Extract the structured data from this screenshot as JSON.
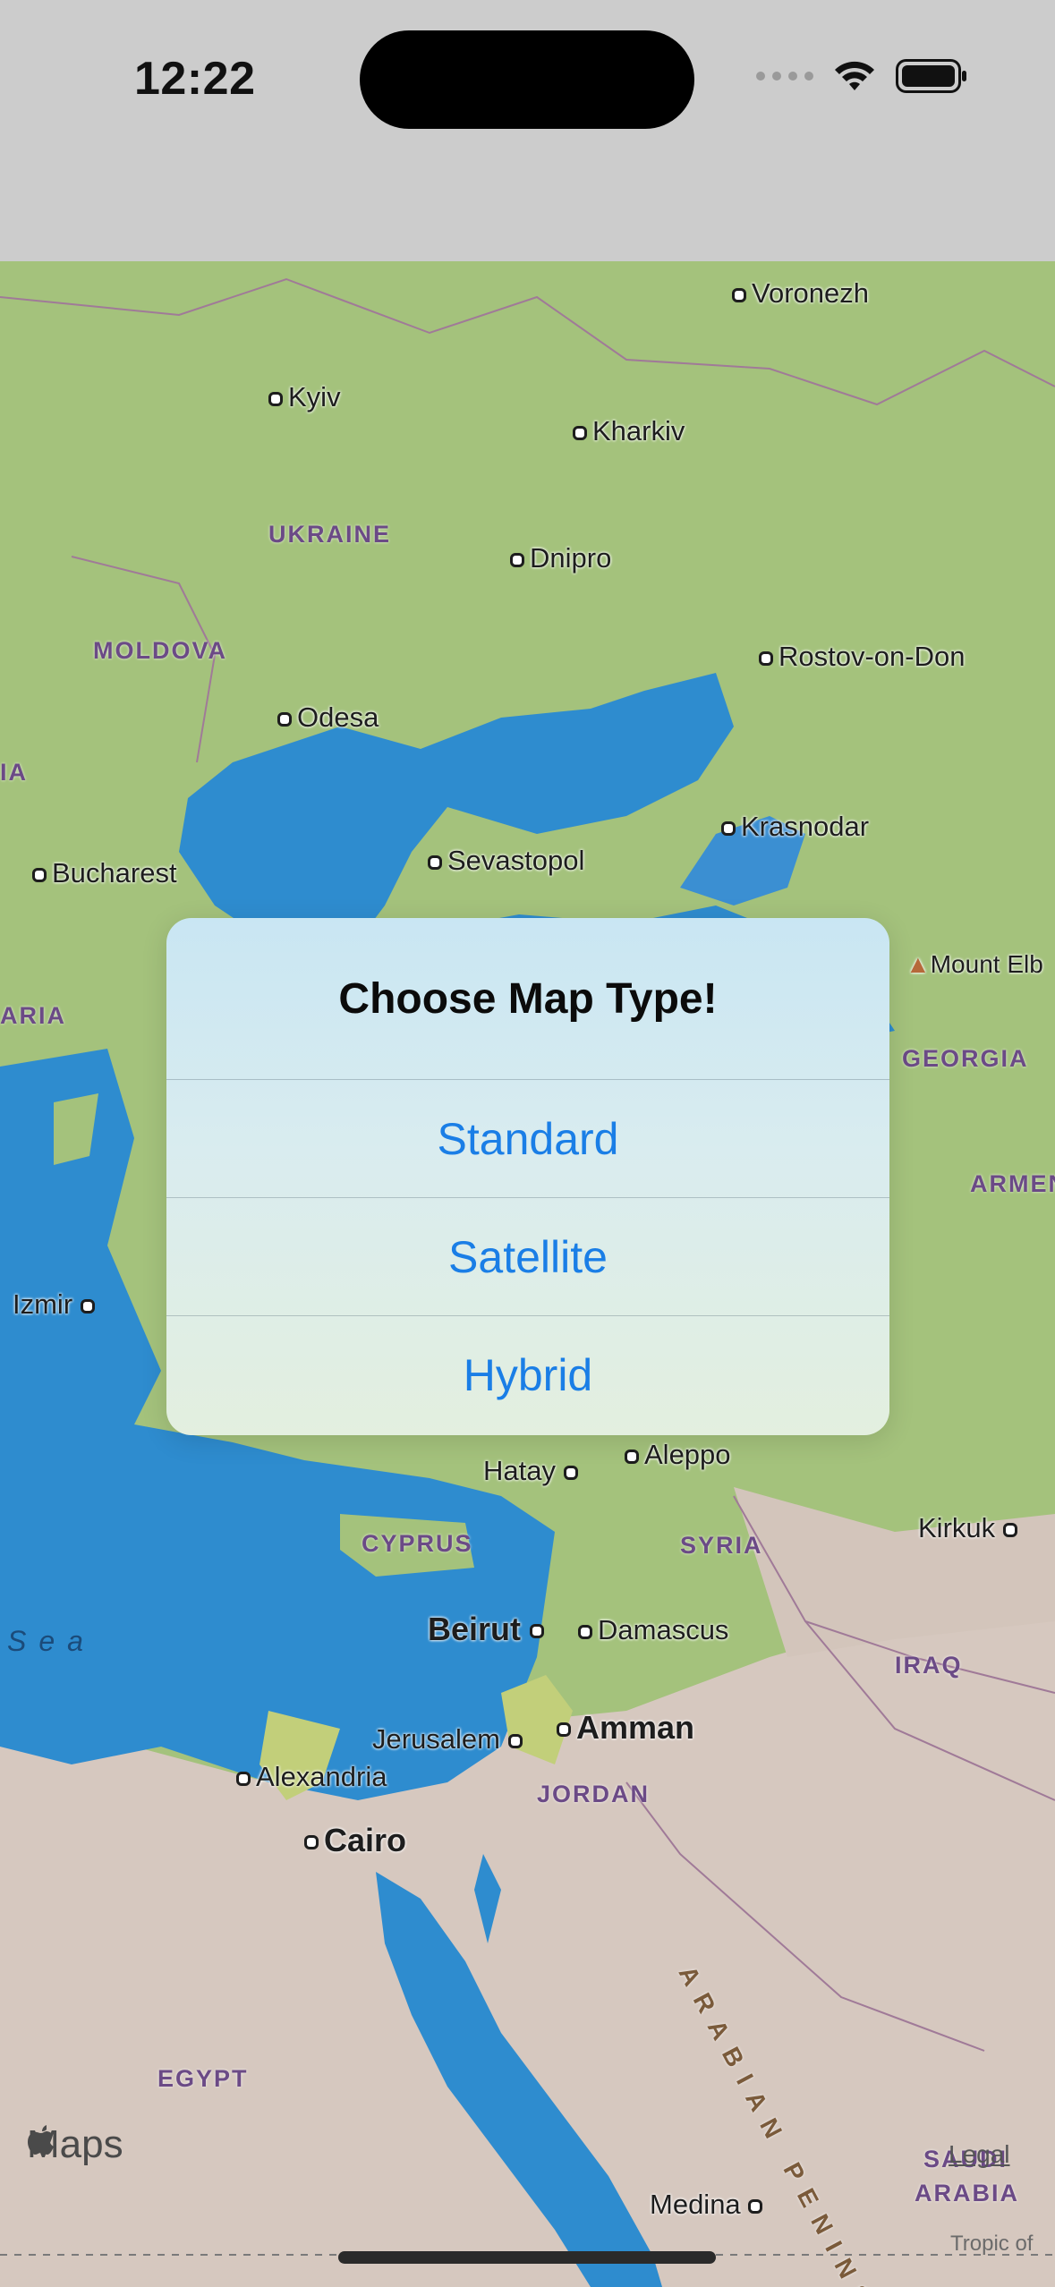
{
  "status_bar": {
    "time": "12:22"
  },
  "map": {
    "cities": [
      {
        "name": "Voronezh",
        "big": false
      },
      {
        "name": "Kyiv",
        "big": false
      },
      {
        "name": "Kharkiv",
        "big": false
      },
      {
        "name": "Dnipro",
        "big": false
      },
      {
        "name": "Rostov-on-Don",
        "big": false
      },
      {
        "name": "Odesa",
        "big": false
      },
      {
        "name": "Krasnodar",
        "big": false
      },
      {
        "name": "Sevastopol",
        "big": false
      },
      {
        "name": "Bucharest",
        "big": false
      },
      {
        "name": "Izmir",
        "big": false
      },
      {
        "name": "Hatay",
        "big": false
      },
      {
        "name": "Aleppo",
        "big": false
      },
      {
        "name": "Kirkuk",
        "big": false
      },
      {
        "name": "Beirut",
        "big": true
      },
      {
        "name": "Damascus",
        "big": false
      },
      {
        "name": "Jerusalem",
        "big": false
      },
      {
        "name": "Amman",
        "big": true
      },
      {
        "name": "Alexandria",
        "big": false
      },
      {
        "name": "Cairo",
        "big": true
      },
      {
        "name": "Medina",
        "big": false
      }
    ],
    "countries": [
      "UKRAINE",
      "MOLDOVA",
      "GEORGIA",
      "ARMEN",
      "CYPRUS",
      "SYRIA",
      "IRAQ",
      "JORDAN",
      "EGYPT",
      "SAUDI",
      "ARABIA",
      "IA",
      "ARIA"
    ],
    "peaks": [
      "Mount Elb"
    ],
    "sea_label": "Sea",
    "region_label": "ARABIAN PENINSULA",
    "maps_brand": "Maps",
    "legal": "Legal",
    "tropic": "Tropic of"
  },
  "alert": {
    "title": "Choose Map Type!",
    "options": [
      "Standard",
      "Satellite",
      "Hybrid"
    ]
  },
  "colors": {
    "accent": "#1a7ee6",
    "land": "#a4c27c",
    "water": "#2e8ccf",
    "desert": "#d6c8bf"
  }
}
